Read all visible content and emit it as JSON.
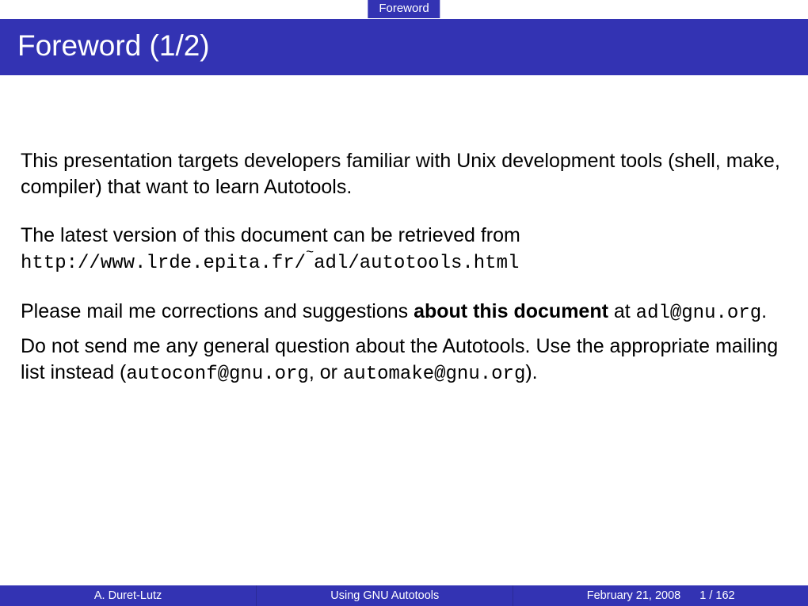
{
  "section": "Foreword",
  "title": "Foreword (1/2)",
  "content": {
    "p1": "This presentation targets developers familiar with Unix development tools (shell, make, compiler) that want to learn Autotools.",
    "p2_a": "The latest version of this document can be retrieved from",
    "p2_url_a": "http://www.lrde.epita.fr/",
    "p2_url_b": "adl/autotools.html",
    "p3_a": "Please mail me corrections and suggestions ",
    "p3_strong": "about this document",
    "p3_b": " at ",
    "p3_email": "adl@gnu.org",
    "p3_c": ".",
    "p4_a": "Do not send me any general question about the Autotools. Use the appropriate mailing list instead (",
    "p4_email1": "autoconf@gnu.org",
    "p4_b": ", or ",
    "p4_email2": "automake@gnu.org",
    "p4_c": ")."
  },
  "footer": {
    "author": "A. Duret-Lutz",
    "title": "Using GNU Autotools",
    "date": "February 21, 2008",
    "page": "1 / 162"
  }
}
